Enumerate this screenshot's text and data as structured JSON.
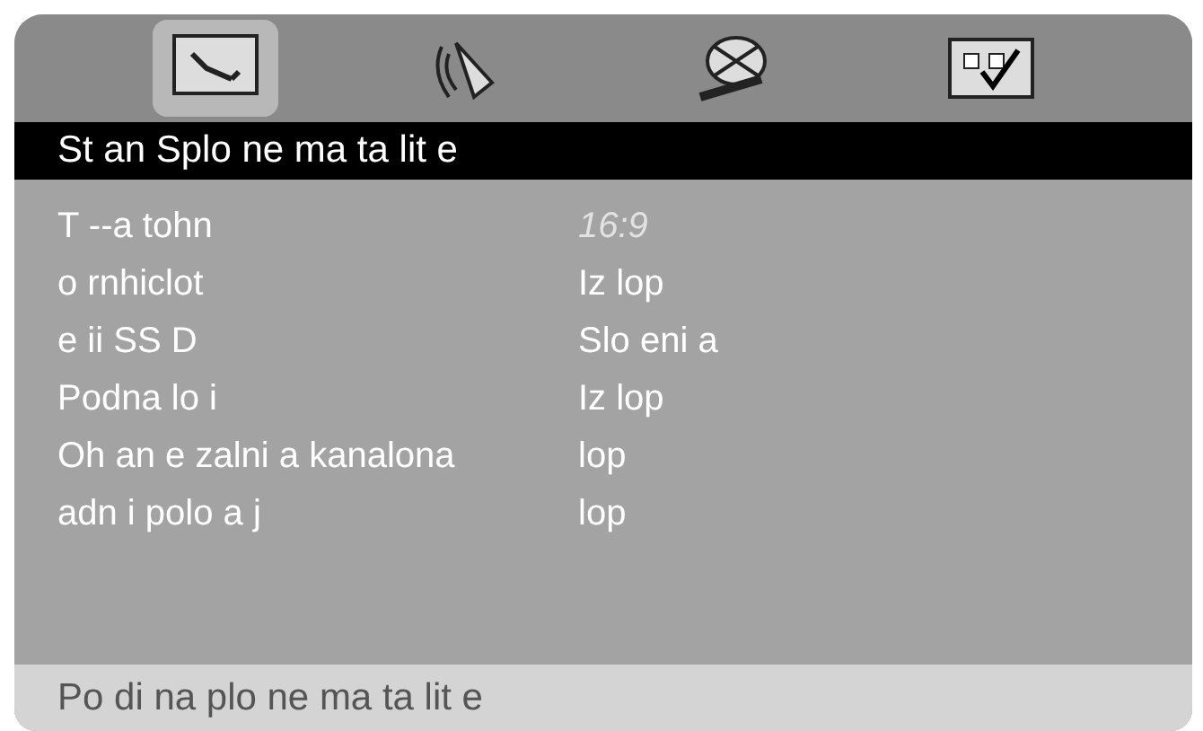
{
  "tabs": [
    {
      "kind": "settings",
      "selected": true
    },
    {
      "kind": "sound",
      "selected": false
    },
    {
      "kind": "reel",
      "selected": false
    },
    {
      "kind": "grid",
      "selected": false
    }
  ],
  "header": {
    "title": "St an Splo ne ma ta lit e"
  },
  "rows": [
    {
      "label": "T --a tohn",
      "value": "16:9",
      "disabled": true
    },
    {
      "label": "o rnhiclot",
      "value": "Iz lop",
      "disabled": false
    },
    {
      "label": "e ii SS D",
      "value": "Slo eni a",
      "disabled": false
    },
    {
      "label": "Podna lo i",
      "value": "Iz lop",
      "disabled": false
    },
    {
      "label": "Oh an e zalni a kanalona",
      "value": "lop",
      "disabled": false
    },
    {
      "label": "adn i polo a j",
      "value": "lop",
      "disabled": false
    }
  ],
  "footer": {
    "text": "Po di na plo ne ma ta lit e"
  }
}
